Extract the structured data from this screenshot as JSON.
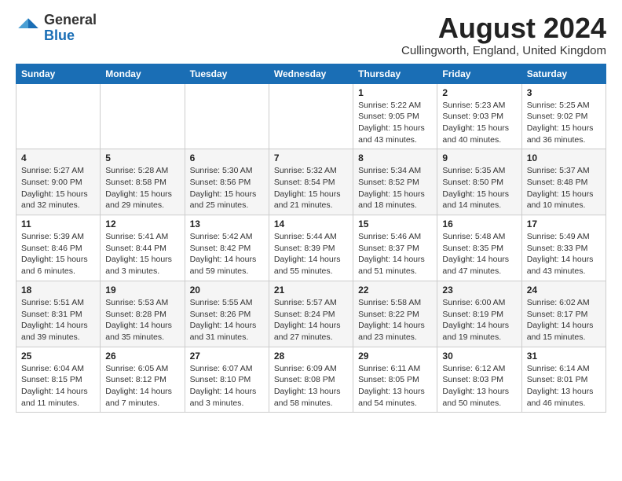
{
  "header": {
    "logo": {
      "general": "General",
      "blue": "Blue"
    },
    "month_title": "August 2024",
    "location": "Cullingworth, England, United Kingdom"
  },
  "calendar": {
    "days_of_week": [
      "Sunday",
      "Monday",
      "Tuesday",
      "Wednesday",
      "Thursday",
      "Friday",
      "Saturday"
    ],
    "weeks": [
      [
        {
          "day": "",
          "info": ""
        },
        {
          "day": "",
          "info": ""
        },
        {
          "day": "",
          "info": ""
        },
        {
          "day": "",
          "info": ""
        },
        {
          "day": "1",
          "info": "Sunrise: 5:22 AM\nSunset: 9:05 PM\nDaylight: 15 hours\nand 43 minutes."
        },
        {
          "day": "2",
          "info": "Sunrise: 5:23 AM\nSunset: 9:03 PM\nDaylight: 15 hours\nand 40 minutes."
        },
        {
          "day": "3",
          "info": "Sunrise: 5:25 AM\nSunset: 9:02 PM\nDaylight: 15 hours\nand 36 minutes."
        }
      ],
      [
        {
          "day": "4",
          "info": "Sunrise: 5:27 AM\nSunset: 9:00 PM\nDaylight: 15 hours\nand 32 minutes."
        },
        {
          "day": "5",
          "info": "Sunrise: 5:28 AM\nSunset: 8:58 PM\nDaylight: 15 hours\nand 29 minutes."
        },
        {
          "day": "6",
          "info": "Sunrise: 5:30 AM\nSunset: 8:56 PM\nDaylight: 15 hours\nand 25 minutes."
        },
        {
          "day": "7",
          "info": "Sunrise: 5:32 AM\nSunset: 8:54 PM\nDaylight: 15 hours\nand 21 minutes."
        },
        {
          "day": "8",
          "info": "Sunrise: 5:34 AM\nSunset: 8:52 PM\nDaylight: 15 hours\nand 18 minutes."
        },
        {
          "day": "9",
          "info": "Sunrise: 5:35 AM\nSunset: 8:50 PM\nDaylight: 15 hours\nand 14 minutes."
        },
        {
          "day": "10",
          "info": "Sunrise: 5:37 AM\nSunset: 8:48 PM\nDaylight: 15 hours\nand 10 minutes."
        }
      ],
      [
        {
          "day": "11",
          "info": "Sunrise: 5:39 AM\nSunset: 8:46 PM\nDaylight: 15 hours\nand 6 minutes."
        },
        {
          "day": "12",
          "info": "Sunrise: 5:41 AM\nSunset: 8:44 PM\nDaylight: 15 hours\nand 3 minutes."
        },
        {
          "day": "13",
          "info": "Sunrise: 5:42 AM\nSunset: 8:42 PM\nDaylight: 14 hours\nand 59 minutes."
        },
        {
          "day": "14",
          "info": "Sunrise: 5:44 AM\nSunset: 8:39 PM\nDaylight: 14 hours\nand 55 minutes."
        },
        {
          "day": "15",
          "info": "Sunrise: 5:46 AM\nSunset: 8:37 PM\nDaylight: 14 hours\nand 51 minutes."
        },
        {
          "day": "16",
          "info": "Sunrise: 5:48 AM\nSunset: 8:35 PM\nDaylight: 14 hours\nand 47 minutes."
        },
        {
          "day": "17",
          "info": "Sunrise: 5:49 AM\nSunset: 8:33 PM\nDaylight: 14 hours\nand 43 minutes."
        }
      ],
      [
        {
          "day": "18",
          "info": "Sunrise: 5:51 AM\nSunset: 8:31 PM\nDaylight: 14 hours\nand 39 minutes."
        },
        {
          "day": "19",
          "info": "Sunrise: 5:53 AM\nSunset: 8:28 PM\nDaylight: 14 hours\nand 35 minutes."
        },
        {
          "day": "20",
          "info": "Sunrise: 5:55 AM\nSunset: 8:26 PM\nDaylight: 14 hours\nand 31 minutes."
        },
        {
          "day": "21",
          "info": "Sunrise: 5:57 AM\nSunset: 8:24 PM\nDaylight: 14 hours\nand 27 minutes."
        },
        {
          "day": "22",
          "info": "Sunrise: 5:58 AM\nSunset: 8:22 PM\nDaylight: 14 hours\nand 23 minutes."
        },
        {
          "day": "23",
          "info": "Sunrise: 6:00 AM\nSunset: 8:19 PM\nDaylight: 14 hours\nand 19 minutes."
        },
        {
          "day": "24",
          "info": "Sunrise: 6:02 AM\nSunset: 8:17 PM\nDaylight: 14 hours\nand 15 minutes."
        }
      ],
      [
        {
          "day": "25",
          "info": "Sunrise: 6:04 AM\nSunset: 8:15 PM\nDaylight: 14 hours\nand 11 minutes."
        },
        {
          "day": "26",
          "info": "Sunrise: 6:05 AM\nSunset: 8:12 PM\nDaylight: 14 hours\nand 7 minutes."
        },
        {
          "day": "27",
          "info": "Sunrise: 6:07 AM\nSunset: 8:10 PM\nDaylight: 14 hours\nand 3 minutes."
        },
        {
          "day": "28",
          "info": "Sunrise: 6:09 AM\nSunset: 8:08 PM\nDaylight: 13 hours\nand 58 minutes."
        },
        {
          "day": "29",
          "info": "Sunrise: 6:11 AM\nSunset: 8:05 PM\nDaylight: 13 hours\nand 54 minutes."
        },
        {
          "day": "30",
          "info": "Sunrise: 6:12 AM\nSunset: 8:03 PM\nDaylight: 13 hours\nand 50 minutes."
        },
        {
          "day": "31",
          "info": "Sunrise: 6:14 AM\nSunset: 8:01 PM\nDaylight: 13 hours\nand 46 minutes."
        }
      ]
    ]
  }
}
